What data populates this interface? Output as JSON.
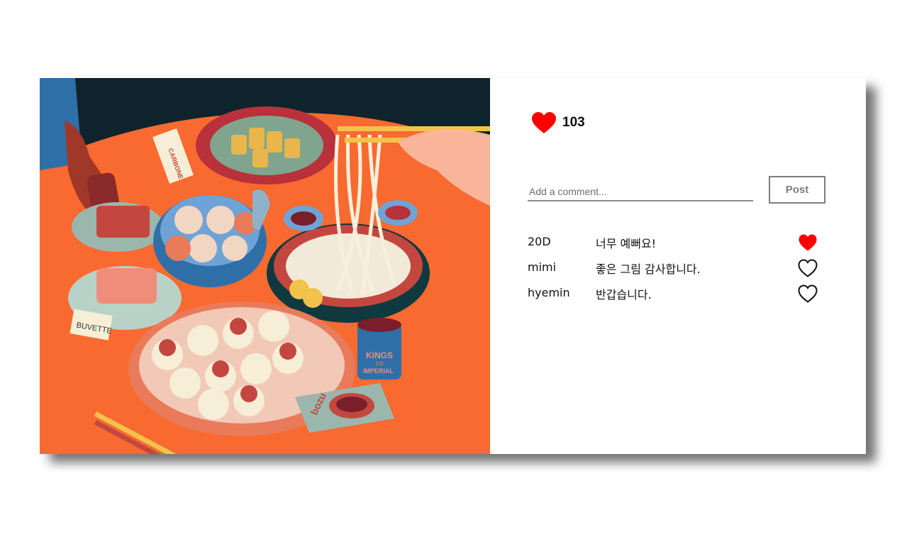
{
  "post": {
    "image_alt": "Illustration of a table with dishes",
    "image_signs": {
      "sign1": "CARBONE",
      "sign2": "BUVETTE",
      "sign3": "bozu",
      "can_line1": "KINGS",
      "can_line2": "CO",
      "can_line3": "IMPERIAL"
    },
    "likes_count": "103",
    "like_icon": "heart-icon",
    "like_color": "#ff0000"
  },
  "comment_form": {
    "placeholder": "Add a comment...",
    "post_label": "Post"
  },
  "comments": [
    {
      "user": "20D",
      "text": "너무 예뻐요!",
      "liked": true
    },
    {
      "user": "mimi",
      "text": "좋은 그림 감사합니다.",
      "liked": false
    },
    {
      "user": "hyemin",
      "text": "반갑습니다.",
      "liked": false
    }
  ],
  "colors": {
    "accent": "#ff0000",
    "button_border": "#7d7d7d",
    "table_orange": "#f86a30",
    "dark_bg": "#0e232c"
  }
}
